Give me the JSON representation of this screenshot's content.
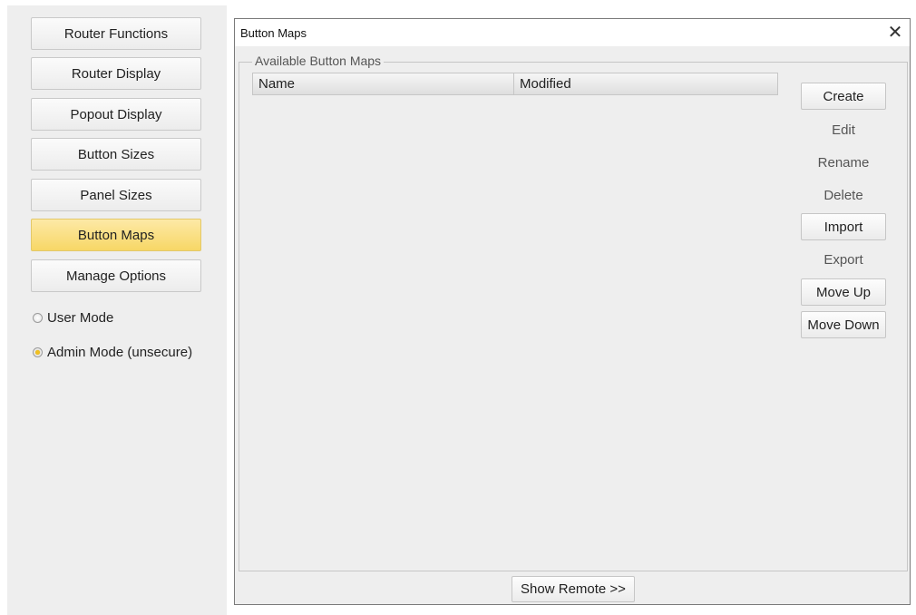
{
  "sidebar": {
    "items": [
      {
        "label": "Router Functions",
        "active": false
      },
      {
        "label": "Router Display",
        "active": false
      },
      {
        "label": "Popout Display",
        "active": false
      },
      {
        "label": "Button Sizes",
        "active": false
      },
      {
        "label": "Panel Sizes",
        "active": false
      },
      {
        "label": "Button Maps",
        "active": true
      },
      {
        "label": "Manage Options",
        "active": false
      }
    ],
    "modes": [
      {
        "label": "User Mode",
        "checked": false
      },
      {
        "label": "Admin Mode (unsecure)",
        "checked": true
      }
    ]
  },
  "dialog": {
    "title": "Button Maps",
    "close_glyph": "✕",
    "group_label": "Available Button Maps",
    "table": {
      "columns": [
        "Name",
        "Modified"
      ],
      "rows": []
    },
    "actions": [
      {
        "label": "Create",
        "enabled": true
      },
      {
        "label": "Edit",
        "enabled": false
      },
      {
        "label": "Rename",
        "enabled": false
      },
      {
        "label": "Delete",
        "enabled": false
      },
      {
        "label": "Import",
        "enabled": true
      },
      {
        "label": "Export",
        "enabled": false
      },
      {
        "label": "Move Up",
        "enabled": true
      },
      {
        "label": "Move Down",
        "enabled": true
      }
    ],
    "show_remote_label": "Show Remote >>"
  },
  "colors": {
    "active_nav": "#f7d766",
    "radio_checked": "#f0c020"
  }
}
